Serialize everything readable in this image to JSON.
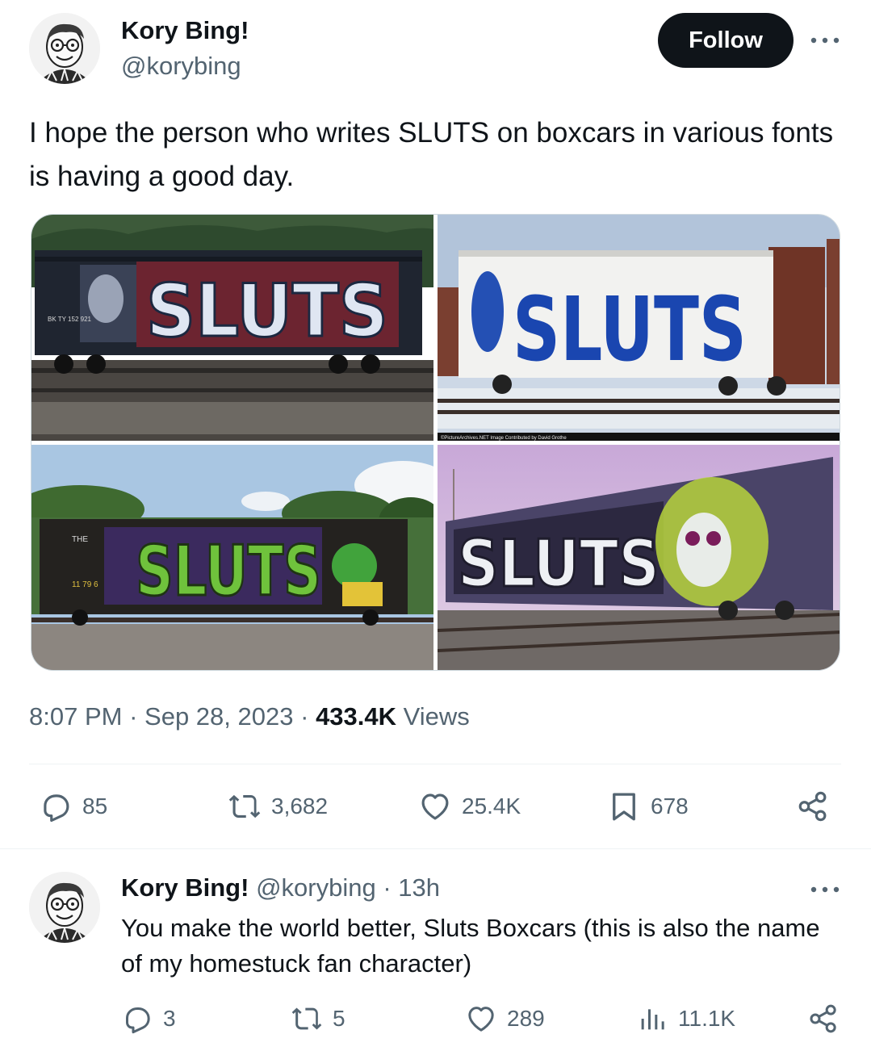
{
  "tweet": {
    "author_name": "Kory Bing!",
    "author_handle": "@korybing",
    "follow_label": "Follow",
    "text": "I hope the person who writes SLUTS on boxcars in various fonts is having a good day.",
    "time": "8:07 PM",
    "date": "Sep 28, 2023",
    "views_count": "433.4K",
    "views_label": "Views",
    "separator": "·",
    "photos": [
      {
        "graffiti": "SLUTS",
        "marking": "BK TY 152 921"
      },
      {
        "graffiti": "SLUTS",
        "credit": "©PictureArchives.NET Image Contributed by David Grothe"
      },
      {
        "graffiti": "SLUTS",
        "marking": "THE",
        "number": "11 79 6"
      },
      {
        "graffiti": "SLUTS"
      }
    ],
    "actions": {
      "replies": "85",
      "retweets": "3,682",
      "likes": "25.4K",
      "bookmarks": "678"
    },
    "icons": [
      "more-icon",
      "reply-icon",
      "retweet-icon",
      "like-icon",
      "bookmark-icon",
      "share-icon"
    ]
  },
  "reply": {
    "author_name": "Kory Bing!",
    "author_handle": "@korybing",
    "time_ago": "13h",
    "text": "You make the world better, Sluts Boxcars (this is also the name of my homestuck fan character)",
    "actions": {
      "replies": "3",
      "retweets": "5",
      "likes": "289",
      "views": "11.1K"
    },
    "icons": [
      "more-icon",
      "reply-icon",
      "retweet-icon",
      "like-icon",
      "views-icon",
      "share-icon"
    ]
  },
  "colors": {
    "text_primary": "#0f1419",
    "text_secondary": "#536471",
    "button_bg": "#0f1419",
    "divider": "#eff3f4"
  }
}
